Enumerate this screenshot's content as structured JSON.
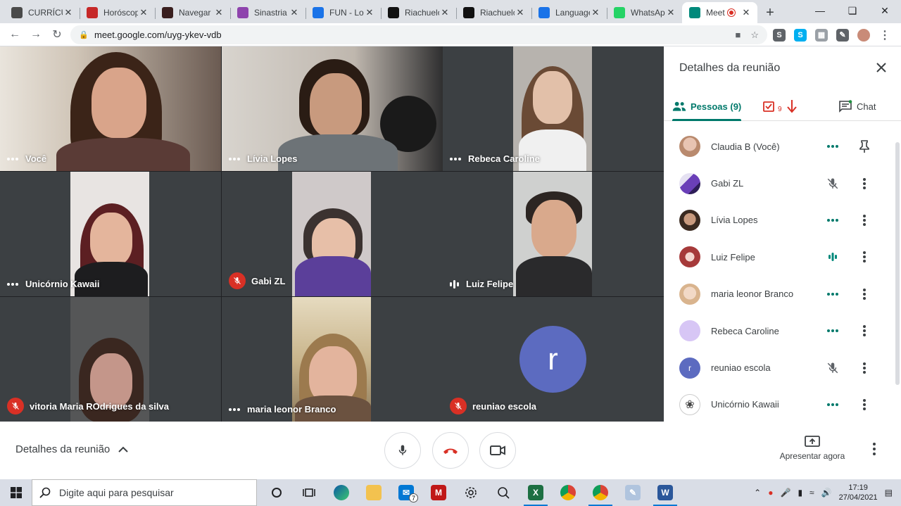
{
  "browser": {
    "tabs": [
      {
        "title": "CURRÍCULO",
        "icon": "document-icon",
        "color": "#4a4a4a"
      },
      {
        "title": "Horóscopo",
        "icon": "m-logo-icon",
        "color": "#c62828"
      },
      {
        "title": "Navegar",
        "icon": "dark-logo-icon",
        "color": "#3a1f1f"
      },
      {
        "title": "Sinastria",
        "icon": "astrology-icon",
        "color": "#8e44ad"
      },
      {
        "title": "FUN - Lo",
        "icon": "google-icon",
        "color": "#1a73e8"
      },
      {
        "title": "Riachuelo",
        "icon": "r-logo-icon",
        "color": "#111111"
      },
      {
        "title": "Riachuelo",
        "icon": "r-logo-icon",
        "color": "#111111"
      },
      {
        "title": "Language",
        "icon": "chat-bubble-icon",
        "color": "#1a73e8"
      },
      {
        "title": "WhatsApp",
        "icon": "whatsapp-icon",
        "color": "#25d366"
      },
      {
        "title": "Meet",
        "icon": "meet-icon",
        "color": "#00897b"
      }
    ],
    "url": "meet.google.com/uyg-ykev-vdb"
  },
  "participants_grid": [
    {
      "name": "Você",
      "status": "dots"
    },
    {
      "name": "Lívia Lopes",
      "status": "dots"
    },
    {
      "name": "Rebeca Caroline",
      "status": "dots"
    },
    {
      "name": "Unicórnio Kawaii",
      "status": "dots"
    },
    {
      "name": "Gabi ZL",
      "status": "muted"
    },
    {
      "name": "Luiz Felipe",
      "status": "speaking"
    },
    {
      "name": "vitoria Maria ROdrigues da silva",
      "status": "muted"
    },
    {
      "name": "maria leonor Branco",
      "status": "dots"
    },
    {
      "name": "reuniao escola",
      "status": "muted",
      "avatar_letter": "r"
    }
  ],
  "panel": {
    "title": "Detalhes da reunião",
    "tab_people": "Pessoas (9)",
    "tab_tasks_count": "9",
    "tab_chat": "Chat",
    "people": [
      {
        "name": "Claudia B (Você)",
        "status": "dots",
        "action": "pin"
      },
      {
        "name": "Gabi ZL",
        "status": "muted",
        "action": "more"
      },
      {
        "name": "Lívia Lopes",
        "status": "dots",
        "action": "more"
      },
      {
        "name": "Luiz Felipe",
        "status": "speaking",
        "action": "more"
      },
      {
        "name": "maria leonor Branco",
        "status": "dots",
        "action": "more"
      },
      {
        "name": "Rebeca Caroline",
        "status": "dots",
        "action": "more"
      },
      {
        "name": "reuniao escola",
        "status": "muted",
        "action": "more",
        "avatar_letter": "r"
      },
      {
        "name": "Unicórnio Kawaii",
        "status": "dots",
        "action": "more"
      }
    ]
  },
  "bottom": {
    "details_label": "Detalhes da reunião",
    "present_label": "Apresentar agora"
  },
  "taskbar": {
    "search_placeholder": "Digite aqui para pesquisar",
    "mail_badge": "7",
    "time": "17:19",
    "date": "27/04/2021"
  },
  "colors": {
    "accent": "#00796b",
    "danger": "#d93025",
    "avatar_r": "#5c6bc0"
  }
}
